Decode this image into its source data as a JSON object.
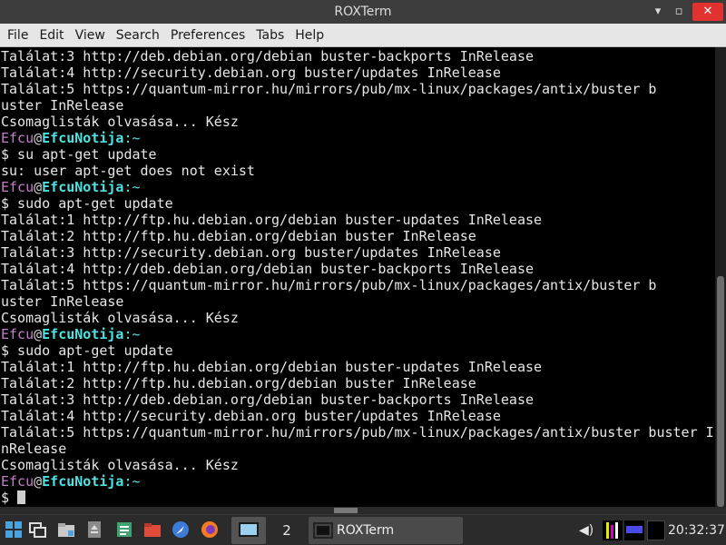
{
  "window": {
    "title": "ROXTerm",
    "minimize": "▾",
    "maximize": "▫",
    "close": "✕"
  },
  "menu": [
    "File",
    "Edit",
    "View",
    "Search",
    "Preferences",
    "Tabs",
    "Help"
  ],
  "terminal": {
    "user": "Efcu",
    "host": "EfcuNotija",
    "path": "~",
    "lines": [
      {
        "t": "out",
        "text": "Találat:3 http://deb.debian.org/debian buster-backports InRelease"
      },
      {
        "t": "out",
        "text": "Találat:4 http://security.debian.org buster/updates InRelease"
      },
      {
        "t": "out",
        "text": "Találat:5 https://quantum-mirror.hu/mirrors/pub/mx-linux/packages/antix/buster b"
      },
      {
        "t": "out",
        "text": "uster InRelease"
      },
      {
        "t": "out",
        "text": "Csomaglisták olvasása... Kész"
      },
      {
        "t": "prompt"
      },
      {
        "t": "cmd",
        "text": "$ su apt-get update"
      },
      {
        "t": "out",
        "text": "su: user apt-get does not exist"
      },
      {
        "t": "prompt"
      },
      {
        "t": "cmd",
        "text": "$ sudo apt-get update"
      },
      {
        "t": "out",
        "text": "Találat:1 http://ftp.hu.debian.org/debian buster-updates InRelease"
      },
      {
        "t": "out",
        "text": "Találat:2 http://ftp.hu.debian.org/debian buster InRelease"
      },
      {
        "t": "out",
        "text": "Találat:3 http://security.debian.org buster/updates InRelease"
      },
      {
        "t": "out",
        "text": "Találat:4 http://deb.debian.org/debian buster-backports InRelease"
      },
      {
        "t": "out",
        "text": "Találat:5 https://quantum-mirror.hu/mirrors/pub/mx-linux/packages/antix/buster b"
      },
      {
        "t": "out",
        "text": "uster InRelease"
      },
      {
        "t": "out",
        "text": "Csomaglisták olvasása... Kész"
      },
      {
        "t": "prompt"
      },
      {
        "t": "cmd",
        "text": "$ sudo apt-get update"
      },
      {
        "t": "out",
        "text": "Találat:1 http://ftp.hu.debian.org/debian buster-updates InRelease"
      },
      {
        "t": "out",
        "text": "Találat:2 http://ftp.hu.debian.org/debian buster InRelease"
      },
      {
        "t": "out",
        "text": "Találat:3 http://deb.debian.org/debian buster-backports InRelease"
      },
      {
        "t": "out",
        "text": "Találat:4 http://security.debian.org buster/updates InRelease"
      },
      {
        "t": "out",
        "text": "Találat:5 https://quantum-mirror.hu/mirrors/pub/mx-linux/packages/antix/buster buster I"
      },
      {
        "t": "out",
        "text": "nRelease"
      },
      {
        "t": "out",
        "text": "Csomaglisták olvasása... Kész"
      },
      {
        "t": "prompt"
      },
      {
        "t": "input",
        "text": "$ "
      }
    ]
  },
  "taskbar": {
    "workspace_2": "2",
    "task_label": "ROXTerm",
    "volume_icon": "◀)",
    "clock": "20:32:37"
  },
  "colors": {
    "user": "#c47ec8",
    "host": "#4ee3e3",
    "close_button": "#e2322f"
  }
}
